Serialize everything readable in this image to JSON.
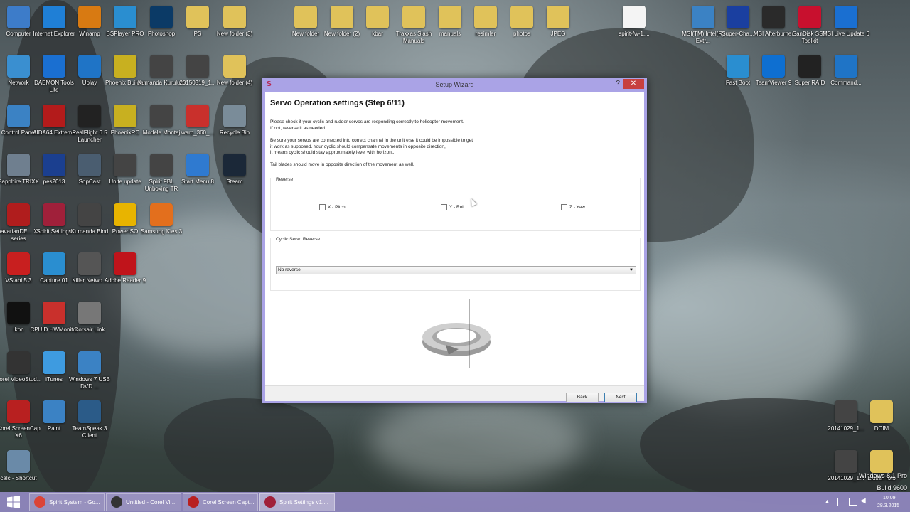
{
  "desktop": {
    "icons_left": [
      {
        "label": "Computer",
        "icon": "computer-icon",
        "color": "#3d7cc9"
      },
      {
        "label": "Internet Explorer",
        "icon": "internet-explorer-icon",
        "color": "#1f7fd6"
      },
      {
        "label": "Winamp",
        "icon": "winamp-icon",
        "color": "#d87a12"
      },
      {
        "label": "BSPlayer PRO",
        "icon": "bsplayer-icon",
        "color": "#2a8ed0"
      },
      {
        "label": "Photoshop",
        "icon": "photoshop-icon",
        "color": "#0b3a66"
      },
      {
        "label": "PS",
        "icon": "folder-icon",
        "color": "#e0c25a"
      },
      {
        "label": "New folder (3)",
        "icon": "folder-icon",
        "color": "#e0c25a"
      },
      {
        "label": "Network",
        "icon": "network-icon",
        "color": "#3a8fd0"
      },
      {
        "label": "DAEMON Tools Lite",
        "icon": "daemon-tools-icon",
        "color": "#1a6fd1"
      },
      {
        "label": "Uplay",
        "icon": "uplay-icon",
        "color": "#1f74c6"
      },
      {
        "label": "Phoenix Builder",
        "icon": "phoenix-icon",
        "color": "#c8b020"
      },
      {
        "label": "Kumanda Kurulum",
        "icon": "video-file-icon",
        "color": "#444"
      },
      {
        "label": "20150319_1...",
        "icon": "video-file-icon",
        "color": "#444"
      },
      {
        "label": "New folder (4)",
        "icon": "folder-icon",
        "color": "#e0c25a"
      },
      {
        "label": "Control Panel",
        "icon": "control-panel-icon",
        "color": "#3b82c4"
      },
      {
        "label": "AIDA64 Extreme",
        "icon": "aida64-icon",
        "color": "#b31b1b"
      },
      {
        "label": "RealFlight 6.5 Launcher",
        "icon": "realflight-icon",
        "color": "#222"
      },
      {
        "label": "PhoenixRC",
        "icon": "phoenix-icon",
        "color": "#c8b020"
      },
      {
        "label": "Modele Montaj",
        "icon": "video-file-icon",
        "color": "#444"
      },
      {
        "label": "warp_360_...",
        "icon": "pdf-icon",
        "color": "#c9302c"
      },
      {
        "label": "Recycle Bin",
        "icon": "recycle-bin-icon",
        "color": "#7a8c99"
      },
      {
        "label": "Sapphire TRIXX",
        "icon": "sapphire-icon",
        "color": "#6f7f8f"
      },
      {
        "label": "pes2013",
        "icon": "pes-icon",
        "color": "#1b3f8f"
      },
      {
        "label": "SopCast",
        "icon": "sopcast-icon",
        "color": "#4a5d70"
      },
      {
        "label": "Unite update",
        "icon": "video-file-icon",
        "color": "#444"
      },
      {
        "label": "Spirit FBL Unboxing TR",
        "icon": "video-file-icon",
        "color": "#444"
      },
      {
        "label": "Start Menu 8",
        "icon": "start-menu-icon",
        "color": "#2f7ad0"
      },
      {
        "label": "Steam",
        "icon": "steam-icon",
        "color": "#1b2838"
      },
      {
        "label": "bavarianDE... X-series",
        "icon": "bavarian-icon",
        "color": "#b01d1d"
      },
      {
        "label": "Spirit Settings",
        "icon": "spirit-icon",
        "color": "#a0203a"
      },
      {
        "label": "Kumanda Bind",
        "icon": "video-file-icon",
        "color": "#444"
      },
      {
        "label": "PowerISO",
        "icon": "poweriso-icon",
        "color": "#e8b400"
      },
      {
        "label": "Samsung Kies 3",
        "icon": "kies-icon",
        "color": "#e36f1d"
      },
      {
        "label": "VStabi 5.3",
        "icon": "vstabi-icon",
        "color": "#c81f1f"
      },
      {
        "label": "Capture 01",
        "icon": "bsplayer-icon",
        "color": "#2a8ed0"
      },
      {
        "label": "Killer Netwo...",
        "icon": "killer-icon",
        "color": "#555"
      },
      {
        "label": "Adobe Reader 9",
        "icon": "adobe-reader-icon",
        "color": "#c0141b"
      },
      {
        "label": "Ikon",
        "icon": "ikon-icon",
        "color": "#111"
      },
      {
        "label": "CPUID HWMonitor",
        "icon": "cpuid-icon",
        "color": "#c9302c"
      },
      {
        "label": "Corsair Link",
        "icon": "corsair-icon",
        "color": "#777"
      },
      {
        "label": "Corel VideoStud...",
        "icon": "corel-video-icon",
        "color": "#333"
      },
      {
        "label": "iTunes",
        "icon": "itunes-icon",
        "color": "#3e9be0"
      },
      {
        "label": "Windows 7 USB DVD ...",
        "icon": "usb-dvd-icon",
        "color": "#3b82c4"
      },
      {
        "label": "Corel ScreenCap X6",
        "icon": "screencap-icon",
        "color": "#b82020"
      },
      {
        "label": "Paint",
        "icon": "paint-icon",
        "color": "#3b82c4"
      },
      {
        "label": "TeamSpeak 3 Client",
        "icon": "teamspeak-icon",
        "color": "#2b5b88"
      },
      {
        "label": "calc - Shortcut",
        "icon": "calculator-icon",
        "color": "#6a8aa8"
      }
    ],
    "icons_top": [
      {
        "label": "New folder",
        "icon": "folder-icon",
        "color": "#e0c25a"
      },
      {
        "label": "New folder (2)",
        "icon": "folder-icon",
        "color": "#e0c25a"
      },
      {
        "label": "kbar",
        "icon": "folder-icon",
        "color": "#e0c25a"
      },
      {
        "label": "Traxxas Slash Manuals",
        "icon": "folder-icon",
        "color": "#e0c25a"
      },
      {
        "label": "manuals",
        "icon": "folder-icon",
        "color": "#e0c25a"
      },
      {
        "label": "resimler",
        "icon": "folder-icon",
        "color": "#e0c25a"
      },
      {
        "label": "photos",
        "icon": "folder-icon",
        "color": "#e0c25a"
      },
      {
        "label": "JPEG",
        "icon": "folder-icon",
        "color": "#e0c25a"
      },
      {
        "label": "spirit-fw-1....",
        "icon": "file-icon",
        "color": "#f4f4f4"
      }
    ],
    "icons_right": [
      {
        "label": "MSI(TM) Intel(R) Extr...",
        "icon": "msi-icon",
        "color": "#3b82c4"
      },
      {
        "label": "Super-Cha...",
        "icon": "super-charger-icon",
        "color": "#1a3fa0"
      },
      {
        "label": "MSI Afterburner",
        "icon": "afterburner-icon",
        "color": "#2a2a2a"
      },
      {
        "label": "SanDisk SSD Toolkit",
        "icon": "sandisk-icon",
        "color": "#c8102e"
      },
      {
        "label": "MSI Live Update 6",
        "icon": "msi-live-icon",
        "color": "#1a6fd1"
      },
      {
        "label": "Fast Boot",
        "icon": "fast-boot-icon",
        "color": "#2a8ed0"
      },
      {
        "label": "TeamViewer 9",
        "icon": "teamviewer-icon",
        "color": "#0e6fd1"
      },
      {
        "label": "Super RAID",
        "icon": "super-raid-icon",
        "color": "#222"
      },
      {
        "label": "Command...",
        "icon": "command-center-icon",
        "color": "#1f74c6"
      },
      {
        "label": "20141029_1...",
        "icon": "video-file-icon",
        "color": "#444"
      },
      {
        "label": "DCIM",
        "icon": "folder-icon",
        "color": "#e0c25a"
      },
      {
        "label": "20141029_1...",
        "icon": "video-file-icon",
        "color": "#444"
      },
      {
        "label": "Ekimin foto",
        "icon": "folder-icon",
        "color": "#e0c25a"
      }
    ]
  },
  "wizard": {
    "title": "Setup Wizard",
    "help": "?",
    "close": "✕",
    "heading": "Servo Operation settings (Step 6/11)",
    "p1_line1": "Please check if your cyclic and rudder servos are responding correctly to helicopter movement.",
    "p1_line2": "If not, reverse it as needed.",
    "p2_line1": "Be sure your servos are connected into correct channel in the unit else it could be impossible to get",
    "p2_line2": "it work as supposed. Your cyclic should compensate movements in opposite direction,",
    "p2_line3": "it means cyclic should stay approximately level with horizont.",
    "p3": "Tail blades should move in opposite direction of the movement as well.",
    "reverse_group": "Reverse",
    "reverse_options": [
      {
        "label": "X - Pitch",
        "checked": false
      },
      {
        "label": "Y - Roll",
        "checked": false
      },
      {
        "label": "Z - Yaw",
        "checked": false
      }
    ],
    "cyclic_group": "Cyclic Servo Reverse",
    "cyclic_value": "No reverse",
    "back": "Back",
    "next": "Next"
  },
  "taskbar": {
    "items": [
      {
        "label": "Spirit System - Go...",
        "icon": "chrome-icon",
        "color": "#db4437"
      },
      {
        "label": "Untitled - Corel Vi...",
        "icon": "corel-video-icon",
        "color": "#333"
      },
      {
        "label": "Corel Screen Capt...",
        "icon": "screencap-icon",
        "color": "#b82020"
      },
      {
        "label": "Spirit Settings v1....",
        "icon": "spirit-icon",
        "color": "#a0203a"
      }
    ],
    "active_index": 3,
    "time": "10:09",
    "date": "28.3.2015"
  },
  "watermark": {
    "line1": "Windows 8.1 Pro",
    "line2": "Build 9600"
  }
}
